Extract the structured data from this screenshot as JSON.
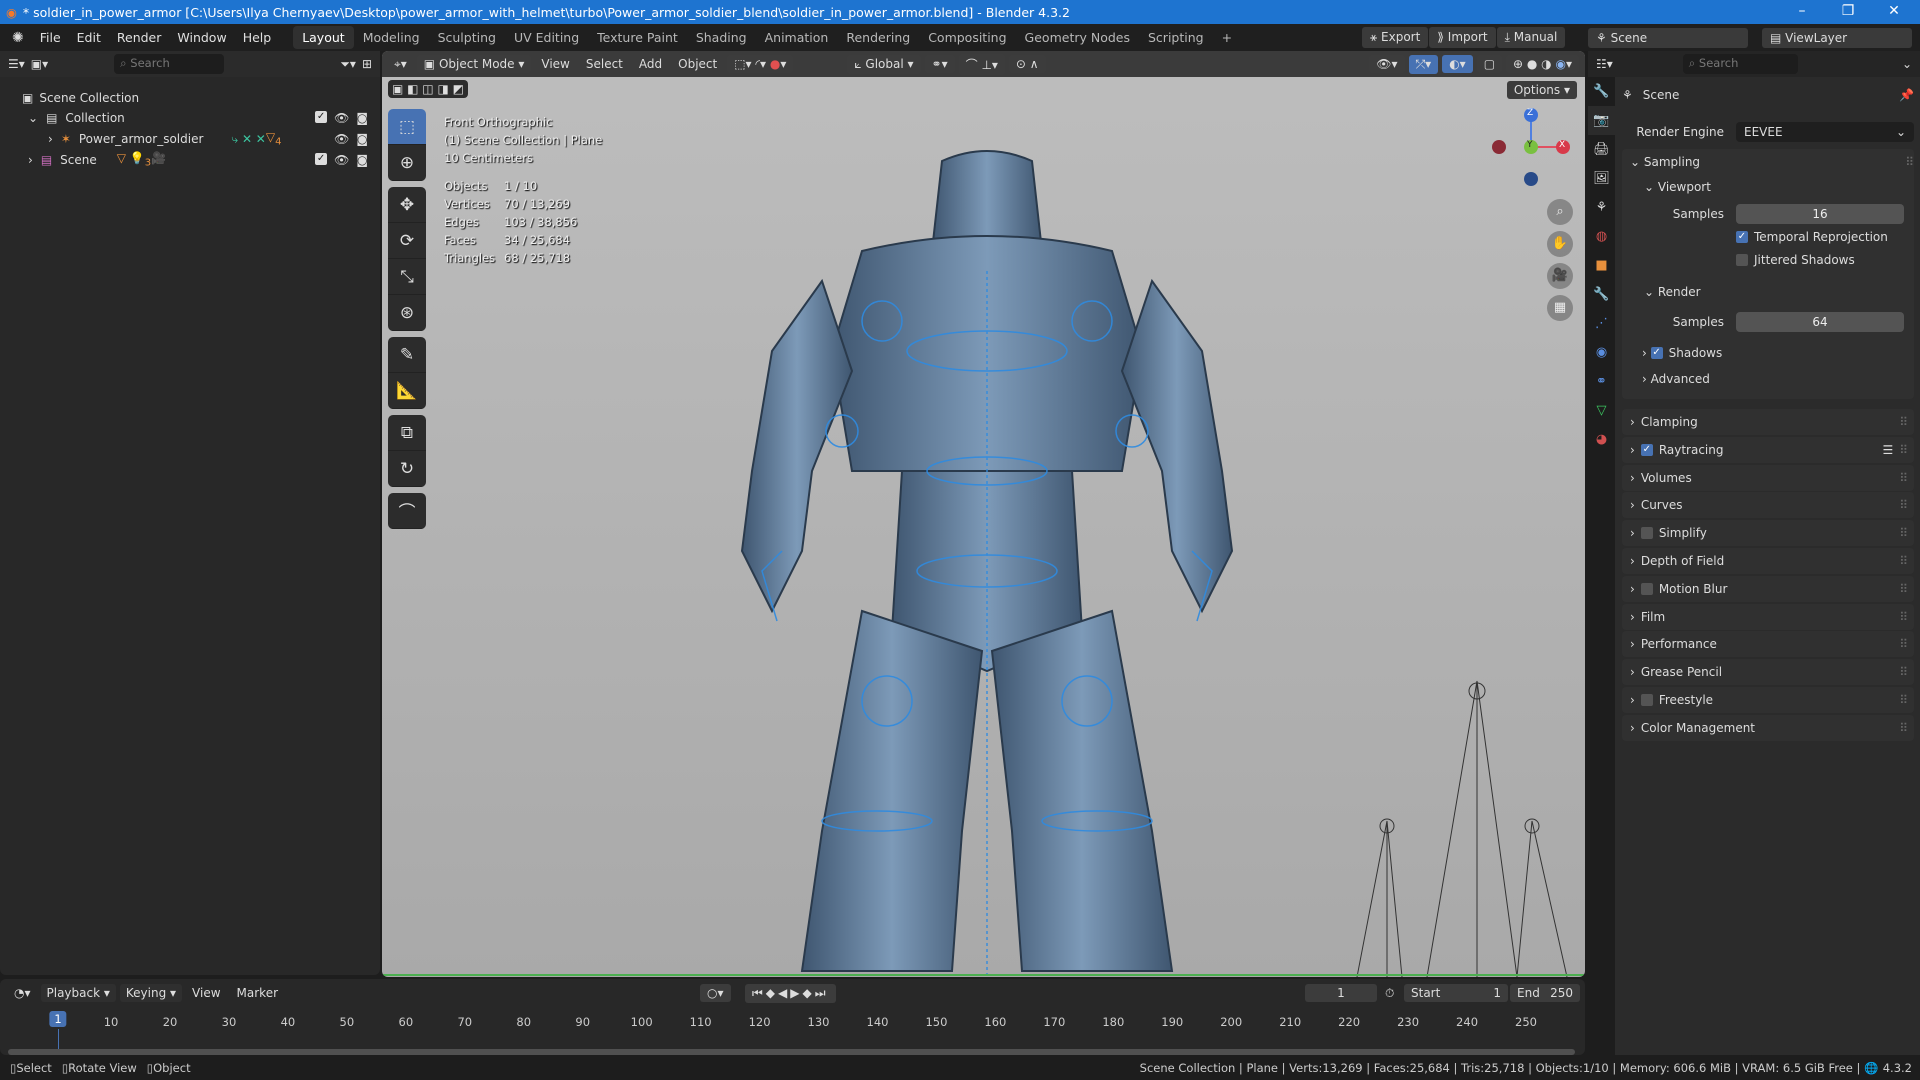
{
  "window": {
    "title": "* soldier_in_power_armor [C:\\Users\\Ilya Chernyaev\\Desktop\\power_armor_with_helmet\\turbo\\Power_armor_soldier_blend\\soldier_in_power_armor.blend] - Blender 4.3.2",
    "minimize": "–",
    "maximize": "❐",
    "close": "✕"
  },
  "menu": [
    "File",
    "Edit",
    "Render",
    "Window",
    "Help"
  ],
  "workspaces": [
    "Layout",
    "Modeling",
    "Sculpting",
    "UV Editing",
    "Texture Paint",
    "Shading",
    "Animation",
    "Rendering",
    "Compositing",
    "Geometry Nodes",
    "Scripting",
    "+"
  ],
  "topright": {
    "export": "Export",
    "import": "Import",
    "manual": "Manual",
    "scene": "Scene",
    "viewlayer": "ViewLayer"
  },
  "outliner": {
    "search_placeholder": "Search",
    "rows": [
      {
        "label": "Scene Collection"
      },
      {
        "label": "Collection"
      },
      {
        "label": "Power_armor_soldier",
        "badge": "4"
      },
      {
        "label": "Scene",
        "badge": "3"
      }
    ]
  },
  "viewport": {
    "mode": "Object Mode",
    "menus": [
      "View",
      "Select",
      "Add",
      "Object"
    ],
    "orientation": "Global",
    "options": "Options",
    "overlay": {
      "view": "Front Orthographic",
      "collection": "(1) Scene Collection | Plane",
      "scale": "10 Centimeters",
      "stats": [
        [
          "Objects",
          "1 / 10"
        ],
        [
          "Vertices",
          "70 / 13,269"
        ],
        [
          "Edges",
          "103 / 38,856"
        ],
        [
          "Faces",
          "34 / 25,684"
        ],
        [
          "Triangles",
          "68 / 25,718"
        ]
      ]
    },
    "gizmo": {
      "z": "Z",
      "y": "Y",
      "x": "X"
    }
  },
  "properties": {
    "search_placeholder": "Search",
    "context": "Scene",
    "render_engine_label": "Render Engine",
    "render_engine": "EEVEE",
    "sampling": "Sampling",
    "viewport": "Viewport",
    "samples_label": "Samples",
    "viewport_samples": "16",
    "temporal": "Temporal Reprojection",
    "jittered": "Jittered Shadows",
    "render": "Render",
    "render_samples": "64",
    "shadows": "Shadows",
    "advanced": "Advanced",
    "panels": [
      {
        "label": "Clamping",
        "check": null
      },
      {
        "label": "Raytracing",
        "check": true
      },
      {
        "label": "Volumes",
        "check": null
      },
      {
        "label": "Curves",
        "check": null
      },
      {
        "label": "Simplify",
        "check": false
      },
      {
        "label": "Depth of Field",
        "check": null
      },
      {
        "label": "Motion Blur",
        "check": false
      },
      {
        "label": "Film",
        "check": null
      },
      {
        "label": "Performance",
        "check": null
      },
      {
        "label": "Grease Pencil",
        "check": null
      },
      {
        "label": "Freestyle",
        "check": false
      },
      {
        "label": "Color Management",
        "check": null
      }
    ]
  },
  "timeline": {
    "menus": [
      "Playback",
      "Keying",
      "View",
      "Marker"
    ],
    "current_frame": "1",
    "start_label": "Start",
    "start": "1",
    "end_label": "End",
    "end": "250",
    "ticks": [
      10,
      20,
      30,
      40,
      50,
      60,
      70,
      80,
      90,
      100,
      110,
      120,
      130,
      140,
      150,
      160,
      170,
      180,
      190,
      200,
      210,
      220,
      230,
      240,
      250
    ]
  },
  "status": {
    "select": "Select",
    "rotate": "Rotate View",
    "object": "Object",
    "info": "Scene Collection | Plane | Verts:13,269 | Faces:25,684 | Tris:25,718 | Objects:1/10 | Memory: 606.6 MiB | VRAM: 6.5 GiB Free |",
    "version": "4.3.2"
  }
}
